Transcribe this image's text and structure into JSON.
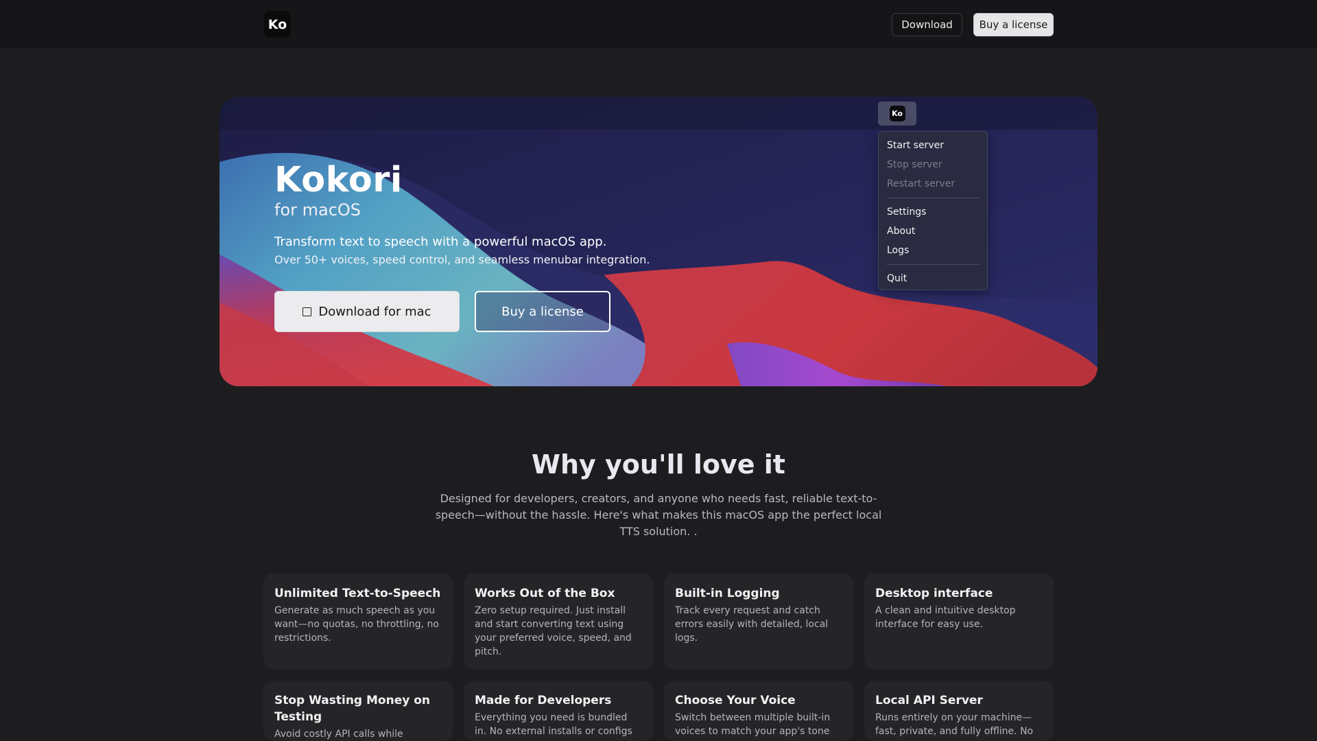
{
  "nav": {
    "logo": "Ko",
    "download_label": "Download",
    "license_label": "Buy a license"
  },
  "hero": {
    "menubar_icon": "Ko",
    "menu_items": [
      {
        "label": "Start server",
        "enabled": true
      },
      {
        "label": "Stop server",
        "enabled": false
      },
      {
        "label": "Restart server",
        "enabled": false
      },
      {
        "label": "Settings",
        "enabled": true
      },
      {
        "label": "About",
        "enabled": true
      },
      {
        "label": "Logs",
        "enabled": true
      },
      {
        "label": "Quit",
        "enabled": true
      }
    ],
    "title": "Kokori",
    "subtitle": "for macOS",
    "lead": "Transform text to speech with a powerful macOS app.",
    "lead2": "Over 50+ voices, speed control, and seamless menubar integration.",
    "download_label": "Download for mac",
    "download_icon": "square-icon",
    "buy_label": "Buy a license"
  },
  "why": {
    "title": "Why you'll love it",
    "description": "Designed for developers, creators, and anyone who needs fast, reliable text-to-speech—without the hassle. Here's what makes this macOS app the perfect local TTS solution. ."
  },
  "features": [
    {
      "title": "Unlimited Text-to-Speech",
      "body": "Generate as much speech as you want—no quotas, no throttling, no restrictions."
    },
    {
      "title": "Works Out of the Box",
      "body": "Zero setup required. Just install and start converting text using your preferred voice, speed, and pitch."
    },
    {
      "title": "Built-in Logging",
      "body": "Track every request and catch errors easily with detailed, local logs."
    },
    {
      "title": "Desktop interface",
      "body": "A clean and intuitive desktop interface for easy use."
    },
    {
      "title": "Stop Wasting Money on Testing",
      "body": "Avoid costly API calls while"
    },
    {
      "title": "Made for Developers",
      "body": "Everything you need is bundled in. No external installs or configs"
    },
    {
      "title": "Choose Your Voice",
      "body": "Switch between multiple built-in voices to match your app's tone"
    },
    {
      "title": "Local API Server",
      "body": "Runs entirely on your machine—fast, private, and fully offline. No"
    }
  ]
}
